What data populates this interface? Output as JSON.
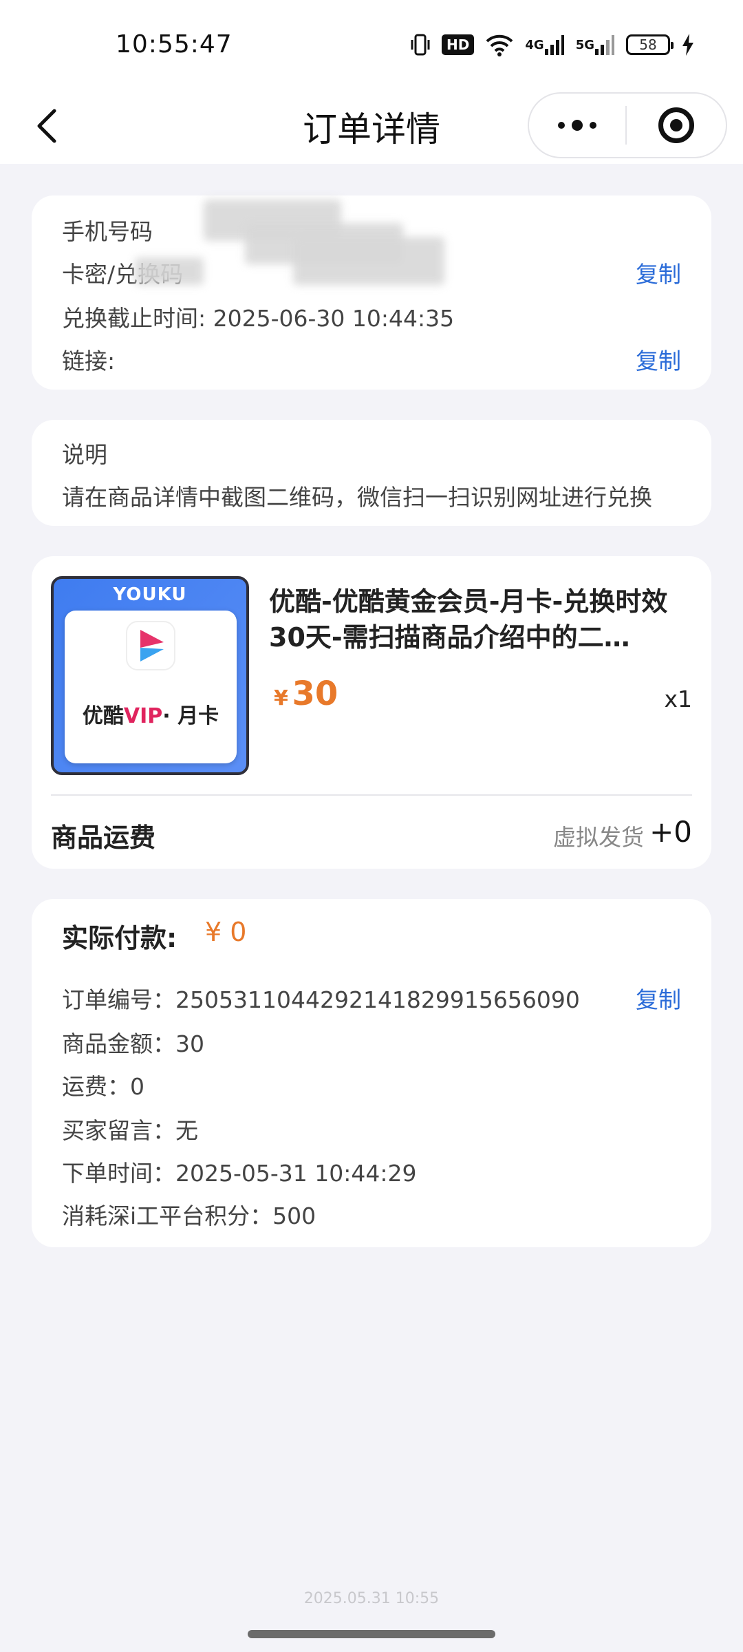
{
  "status": {
    "time": "10:55:47",
    "hd": "HD",
    "net1": "4G",
    "net2": "5G",
    "battery": "58"
  },
  "nav": {
    "title": "订单详情"
  },
  "redeem": {
    "phone_label": "手机号码",
    "code_label": "卡密/兑换码",
    "copy": "复制",
    "deadline_label": "兑换截止时间:",
    "deadline": "2025-06-30 10:44:35",
    "link_label": "链接:"
  },
  "note": {
    "title": "说明",
    "text": "请在商品详情中截图二维码，微信扫一扫识别网址进行兑换"
  },
  "product": {
    "thumb_brand": "YOUKU",
    "thumb_text_a": "优酷",
    "thumb_text_vip": "VIP",
    "thumb_text_b": "· 月卡",
    "title": "优酷-优酷黄金会员-月卡-兑换时效30天-需扫描商品介绍中的二…",
    "currency": "¥",
    "price": "30",
    "qty": "x1",
    "ship_label": "商品运费",
    "ship_type": "虚拟发货",
    "ship_value": "+0"
  },
  "payment": {
    "paid_label": "实际付款:",
    "paid_value": "¥ 0",
    "order_no": "订单编号：2505311044292141829915656090",
    "copy": "复制",
    "amount": "商品金额：30",
    "freight": "运费：0",
    "message": "买家留言：无",
    "order_time": "下单时间：2025-05-31 10:44:29",
    "points": "消耗深i工平台积分：500"
  },
  "watermark": "2025.05.31 10:55",
  "colors": {
    "accent_blue": "#2a6bd8",
    "price_orange": "#e8792a",
    "background": "#f3f3f8"
  }
}
